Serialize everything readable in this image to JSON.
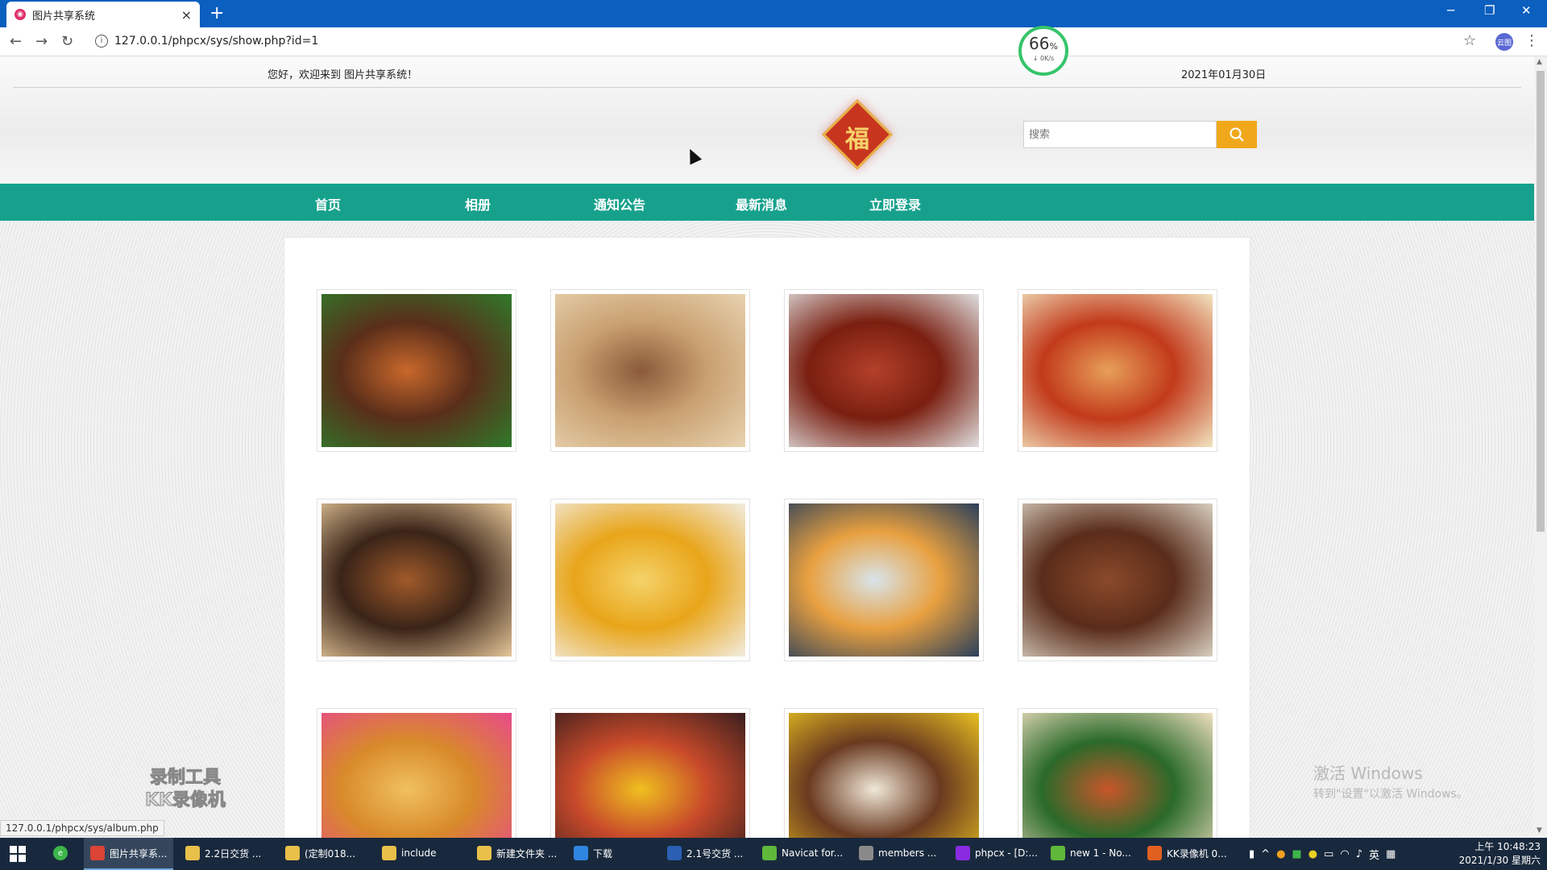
{
  "browser": {
    "tab_title": "图片共享系统",
    "tab_favicon": "app-favicon",
    "url": "127.0.0.1/phpcx/sys/show.php?id=1",
    "status_url": "127.0.0.1/phpcx/sys/album.php",
    "profile_label": "云图"
  },
  "speed_widget": {
    "percent": "66",
    "percent_unit": "%",
    "rate": "↓ 0K/s",
    "ring_color": "#35c46a"
  },
  "header": {
    "welcome": "您好，欢迎来到 图片共享系统！",
    "date": "2021年01月30日",
    "logo_char": "福",
    "search_placeholder": "搜索"
  },
  "nav": {
    "color": "#17a18d",
    "items": [
      "首页",
      "相册",
      "通知公告",
      "最新消息",
      "立即登录"
    ]
  },
  "photos": [
    {
      "name": "seafood-stew",
      "colors": [
        "#5a2e1a",
        "#c9682b",
        "#2f7a2a"
      ]
    },
    {
      "name": "pizza",
      "colors": [
        "#c9a070",
        "#8a5a3a",
        "#e8d3b0"
      ]
    },
    {
      "name": "crayfish",
      "colors": [
        "#7a1f10",
        "#b3402a",
        "#e0e0e0"
      ]
    },
    {
      "name": "spicy-crayfish-box",
      "colors": [
        "#c23a1a",
        "#e8a05a",
        "#f2e4c0"
      ]
    },
    {
      "name": "noodles",
      "colors": [
        "#3a2418",
        "#a05a2a",
        "#e6c89a"
      ]
    },
    {
      "name": "corn-dish",
      "colors": [
        "#e8a51a",
        "#f5d36a",
        "#f2ece0"
      ]
    },
    {
      "name": "noodle-soup",
      "colors": [
        "#e8a040",
        "#d8e4ea",
        "#2a3f5a"
      ]
    },
    {
      "name": "braised-pork",
      "colors": [
        "#5a2c1a",
        "#8a4a2a",
        "#d8cfc0"
      ]
    },
    {
      "name": "roast-chicken",
      "colors": [
        "#d88a2a",
        "#f0c060",
        "#e84a8a"
      ]
    },
    {
      "name": "shrimp-platter",
      "colors": [
        "#c84a2a",
        "#f0c020",
        "#3a1e1e"
      ]
    },
    {
      "name": "duck-rice",
      "colors": [
        "#6a3a20",
        "#f0e8d8",
        "#e8c020"
      ]
    },
    {
      "name": "chicken-rice-box",
      "colors": [
        "#2a6a2a",
        "#c8562a",
        "#f0e0c0"
      ]
    }
  ],
  "overlay": {
    "watermark_line1": "录制工具",
    "watermark_line2": "KK录像机",
    "activate_line1": "激活 Windows",
    "activate_line2": "转到\"设置\"以激活 Windows。"
  },
  "taskbar": {
    "items": [
      {
        "label": "图片共享系...",
        "icon": "chrome-icon",
        "color": "#db4437"
      },
      {
        "label": "2.2日交货 ...",
        "icon": "folder-icon",
        "color": "#e8c04a"
      },
      {
        "label": "(定制018...",
        "icon": "folder-icon",
        "color": "#e8c04a"
      },
      {
        "label": "include",
        "icon": "folder-icon",
        "color": "#e8c04a"
      },
      {
        "label": "新建文件夹 ...",
        "icon": "folder-icon",
        "color": "#e8c04a"
      },
      {
        "label": "下载",
        "icon": "download-icon",
        "color": "#2f86e0"
      },
      {
        "label": "2.1号交货 ...",
        "icon": "word-icon",
        "color": "#2b5fb3"
      },
      {
        "label": "Navicat for...",
        "icon": "navicat-icon",
        "color": "#5fb83a"
      },
      {
        "label": "members ...",
        "icon": "db-icon",
        "color": "#8a8a8a"
      },
      {
        "label": "phpcx - [D:...",
        "icon": "phpstorm-icon",
        "color": "#8a2be2"
      },
      {
        "label": "new 1 - No...",
        "icon": "notepad-icon",
        "color": "#5fb83a"
      },
      {
        "label": "KK录像机 0...",
        "icon": "kk-icon",
        "color": "#e06020"
      }
    ],
    "ime": "英",
    "time": "上午 10:48:23",
    "date": "2021/1/30 星期六"
  }
}
